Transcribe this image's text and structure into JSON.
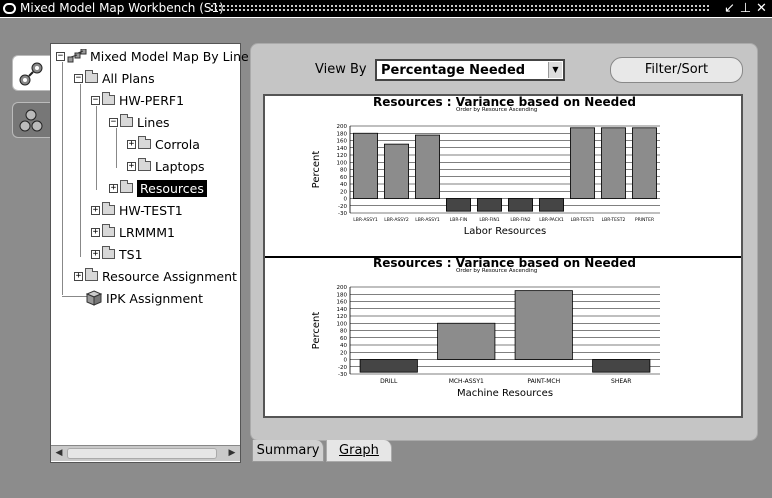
{
  "window": {
    "title": "Mixed Model Map Workbench (S1)",
    "controls": [
      "↙",
      "⊥",
      "✕"
    ]
  },
  "tree": {
    "items": [
      {
        "label": "Mixed Model Map By Line",
        "expander": "−",
        "icon": "hierarchy-icon"
      },
      {
        "label": "All Plans",
        "expander": "−",
        "icon": "folder-icon"
      },
      {
        "label": "HW-PERF1",
        "expander": "−",
        "icon": "folder-icon"
      },
      {
        "label": "Lines",
        "expander": "−",
        "icon": "folder-icon"
      },
      {
        "label": "Corrola",
        "expander": "+",
        "icon": "folder-icon"
      },
      {
        "label": "Laptops",
        "expander": "+",
        "icon": "folder-icon"
      },
      {
        "label": "Resources",
        "expander": "+",
        "icon": "folder-icon",
        "selected": true
      },
      {
        "label": "HW-TEST1",
        "expander": "+",
        "icon": "folder-icon"
      },
      {
        "label": "LRMMM1",
        "expander": "+",
        "icon": "folder-icon"
      },
      {
        "label": "TS1",
        "expander": "+",
        "icon": "folder-icon"
      },
      {
        "label": "Resource Assignment",
        "expander": "+",
        "icon": "folder-icon"
      },
      {
        "label": "IPK Assignment",
        "expander": "",
        "icon": "cube-icon"
      }
    ]
  },
  "toolbar": {
    "view_by_label": "View By",
    "view_by_value": "Percentage Needed",
    "filter_sort_label": "Filter/Sort"
  },
  "tabs": {
    "summary": "Summary",
    "graph": "Graph"
  },
  "chart_data": [
    {
      "type": "bar",
      "title": "Resources : Variance based on Needed",
      "subtitle": "Order by Resource Ascending",
      "xlabel": "Labor Resources",
      "ylabel": "Percent",
      "categories": [
        "LBR-ASSY1",
        "LBR-ASSY2",
        "LBR-ASSY1",
        "LBR-FIN",
        "LBR-FIN1",
        "LBR-FIN2",
        "LBR-PACK1",
        "LBR-TEST1",
        "LBR-TEST2",
        "PRINTER"
      ],
      "values": [
        180,
        150,
        175,
        -35,
        -35,
        -35,
        -35,
        195,
        195,
        195
      ],
      "yticks": [
        200,
        180,
        160,
        140,
        120,
        100,
        80,
        60,
        40,
        20,
        0,
        -20,
        -40
      ],
      "ytick_labels": [
        "200",
        "180",
        "160",
        "140",
        "120",
        "100",
        "80",
        "60",
        "40",
        "20",
        "0",
        "-20",
        "-30"
      ],
      "ylim": [
        -30,
        200
      ],
      "colors": {
        "positive": "#8c8c8c",
        "negative": "#454545"
      }
    },
    {
      "type": "bar",
      "title": "Resources : Variance based on Needed",
      "subtitle": "Order by Resource Ascending",
      "xlabel": "Machine Resources",
      "ylabel": "Percent",
      "categories": [
        "DRILL",
        "MCH-ASSY1",
        "PAINT-MCH",
        "SHEAR"
      ],
      "values": [
        -35,
        100,
        190,
        -35
      ],
      "yticks": [
        200,
        180,
        160,
        140,
        120,
        100,
        80,
        60,
        40,
        20,
        0,
        -20,
        -40
      ],
      "ytick_labels": [
        "200",
        "180",
        "160",
        "140",
        "120",
        "100",
        "80",
        "60",
        "40",
        "20",
        "0",
        "-20",
        "-30"
      ],
      "ylim": [
        -30,
        200
      ],
      "colors": {
        "positive": "#8c8c8c",
        "negative": "#454545"
      }
    }
  ]
}
